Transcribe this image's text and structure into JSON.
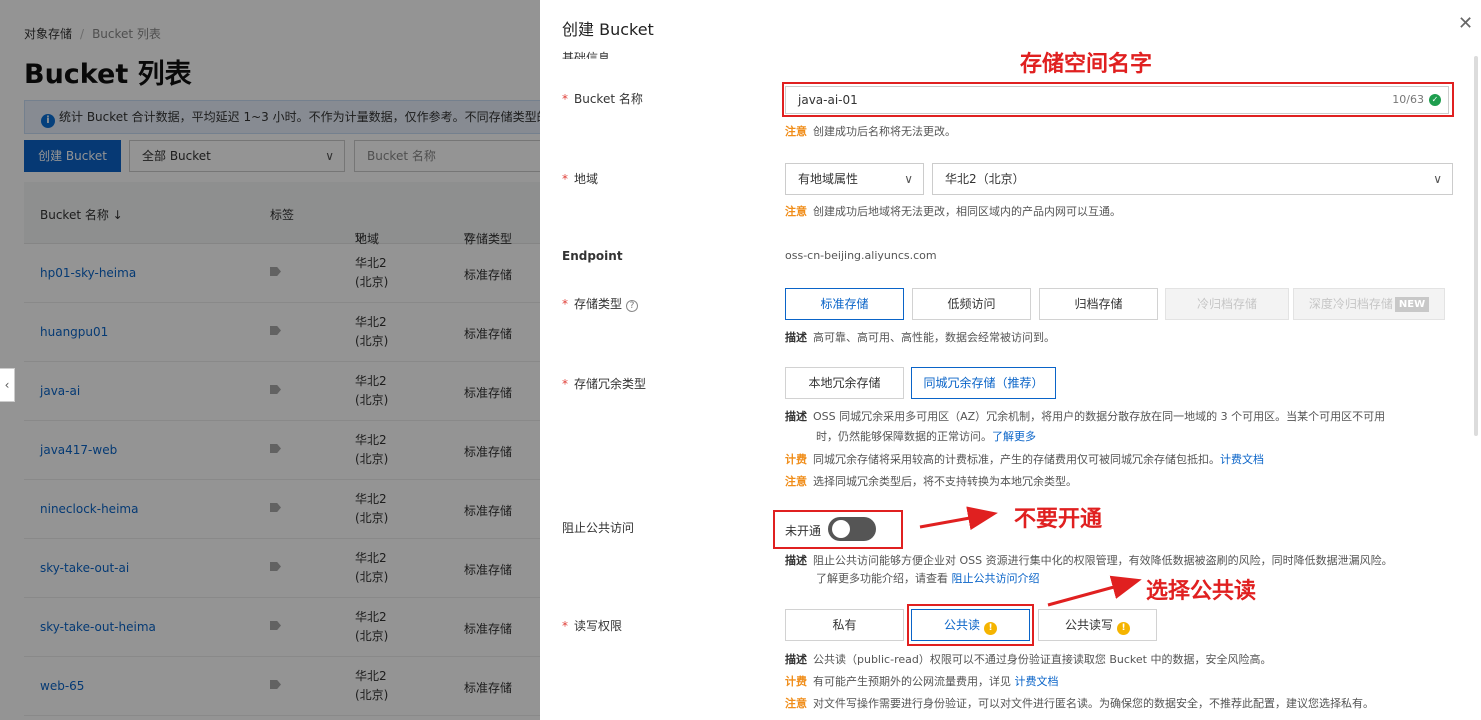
{
  "background": {
    "breadcrumb": {
      "root": "对象存储",
      "separator": "/",
      "current": "Bucket 列表"
    },
    "page_title": "Bucket 列表",
    "info_text": "统计 Bucket 合计数据，平均延迟 1~3 小时。不作为计量数据，仅作参考。不同存储类型的存",
    "create_button": "创建 Bucket",
    "filter_select": "全部 Bucket",
    "search_placeholder": "Bucket 名称",
    "columns": {
      "name": "Bucket 名称 ↓",
      "tag": "标签",
      "region": "地域",
      "storage": "存储类型"
    },
    "rows": [
      {
        "name": "hp01-sky-heima",
        "region_line1": "华北2",
        "region_line2": "(北京)",
        "storage": "标准存储"
      },
      {
        "name": "huangpu01",
        "region_line1": "华北2",
        "region_line2": "(北京)",
        "storage": "标准存储"
      },
      {
        "name": "java-ai",
        "region_line1": "华北2",
        "region_line2": "(北京)",
        "storage": "标准存储"
      },
      {
        "name": "java417-web",
        "region_line1": "华北2",
        "region_line2": "(北京)",
        "storage": "标准存储"
      },
      {
        "name": "nineclock-heima",
        "region_line1": "华北2",
        "region_line2": "(北京)",
        "storage": "标准存储"
      },
      {
        "name": "sky-take-out-ai",
        "region_line1": "华北2",
        "region_line2": "(北京)",
        "storage": "标准存储"
      },
      {
        "name": "sky-take-out-heima",
        "region_line1": "华北2",
        "region_line2": "(北京)",
        "storage": "标准存储"
      },
      {
        "name": "web-65",
        "region_line1": "华北2",
        "region_line2": "(北京)",
        "storage": "标准存储"
      }
    ]
  },
  "drawer": {
    "title": "创建 Bucket",
    "section_cut": "基础信息",
    "bucket_name": {
      "label": "Bucket 名称",
      "value": "java-ai-01",
      "counter": "10/63",
      "note_key": "注意",
      "note": "创建成功后名称将无法更改。"
    },
    "region": {
      "label": "地域",
      "attr_select": "有地域属性",
      "region_select": "华北2（北京）",
      "note_key": "注意",
      "note": "创建成功后地域将无法更改，相同区域内的产品内网可以互通。"
    },
    "endpoint": {
      "label": "Endpoint",
      "value": "oss-cn-beijing.aliyuncs.com"
    },
    "storage_type": {
      "label": "存储类型",
      "options": [
        "标准存储",
        "低频访问",
        "归档存储",
        "冷归档存储",
        "深度冷归档存储"
      ],
      "new_badge": "NEW",
      "desc_key": "描述",
      "desc": "高可靠、高可用、高性能，数据会经常被访问到。"
    },
    "redundancy": {
      "label": "存储冗余类型",
      "options": [
        "本地冗余存储",
        "同城冗余存储（推荐）"
      ],
      "desc_key": "描述",
      "desc_line1": "OSS 同城冗余采用多可用区（AZ）冗余机制，将用户的数据分散存放在同一地域的 3 个可用区。当某个可用区不可用",
      "desc_line2": "时，仍然能够保障数据的正常访问。",
      "desc_link": "了解更多",
      "fee_key": "计费",
      "fee": "同城冗余存储将采用较高的计费标准，产生的存储费用仅可被同城冗余存储包抵扣。",
      "fee_link": "计费文档",
      "note_key": "注意",
      "note": "选择同城冗余类型后，将不支持转换为本地冗余类型。"
    },
    "block_public": {
      "label": "阻止公共访问",
      "toggle_label": "未开通",
      "desc_key": "描述",
      "desc_line1": "阻止公共访问能够方便企业对 OSS 资源进行集中化的权限管理，有效降低数据被盗刷的风险，同时降低数据泄漏风险。",
      "desc_line2": "了解更多功能介绍，请查看",
      "desc_link": "阻止公共访问介绍"
    },
    "acl": {
      "label": "读写权限",
      "options": [
        "私有",
        "公共读",
        "公共读写"
      ],
      "desc_key": "描述",
      "desc": "公共读（public-read）权限可以不通过身份验证直接读取您 Bucket 中的数据，安全风险高。",
      "fee_key": "计费",
      "fee": "有可能产生预期外的公网流量费用，详见",
      "fee_link": "计费文档",
      "note_key": "注意",
      "note": "对文件写操作需要进行身份验证，可以对文件进行匿名读。为确保您的数据安全，不推荐此配置，建议您选择私有。"
    }
  },
  "annotations": {
    "name_hint": "存储空间名字",
    "block_hint": "不要开通",
    "read_hint": "选择公共读"
  },
  "colors": {
    "accent": "#0a64c8",
    "annotation": "#e02020",
    "warn": "#f08d19"
  }
}
